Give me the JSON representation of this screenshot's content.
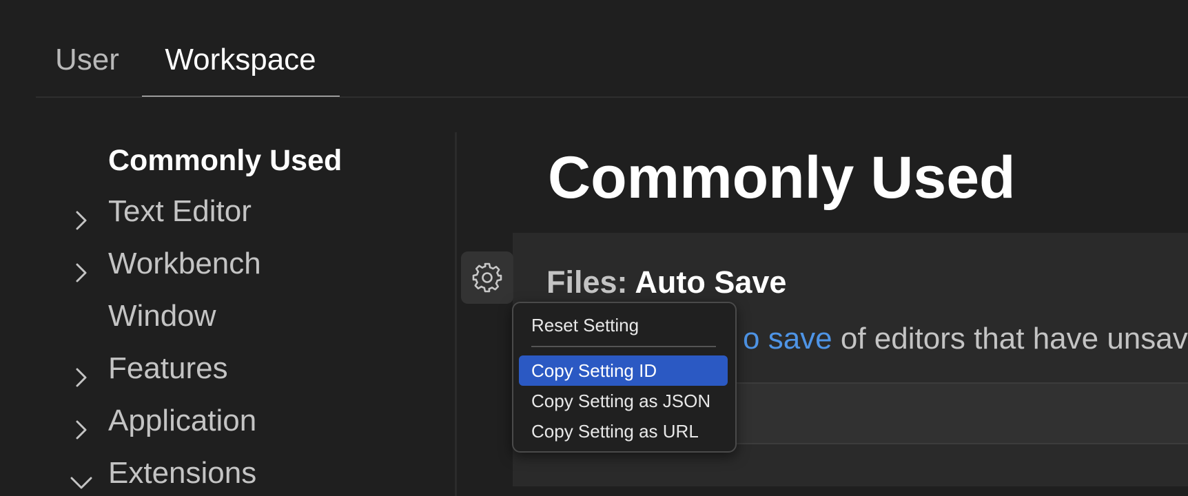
{
  "tabs": [
    {
      "label": "User",
      "active": false
    },
    {
      "label": "Workspace",
      "active": true
    }
  ],
  "sidebar": {
    "items": [
      {
        "label": "Commonly Used",
        "chevron": "none",
        "active": true
      },
      {
        "label": "Text Editor",
        "chevron": "right"
      },
      {
        "label": "Workbench",
        "chevron": "right"
      },
      {
        "label": "Window",
        "chevron": "none"
      },
      {
        "label": "Features",
        "chevron": "right"
      },
      {
        "label": "Application",
        "chevron": "right"
      },
      {
        "label": "Extensions",
        "chevron": "down"
      }
    ]
  },
  "main": {
    "title": "Commonly Used",
    "setting": {
      "category": "Files: ",
      "name": "Auto Save",
      "description_link": "o save",
      "description_rest": " of editors that have unsav"
    }
  },
  "context_menu": {
    "items": [
      {
        "label": "Reset Setting"
      },
      {
        "label": "Copy Setting ID",
        "selected": true
      },
      {
        "label": "Copy Setting as JSON"
      },
      {
        "label": "Copy Setting as URL"
      }
    ]
  },
  "icons": {
    "gear": "gear-icon",
    "chevron_right": "chevron-right-icon",
    "chevron_down": "chevron-down-icon"
  },
  "colors": {
    "background": "#1f1f1f",
    "panel": "#2a2a2a",
    "accent_selection": "#2b59c3",
    "link": "#4e94e6"
  }
}
